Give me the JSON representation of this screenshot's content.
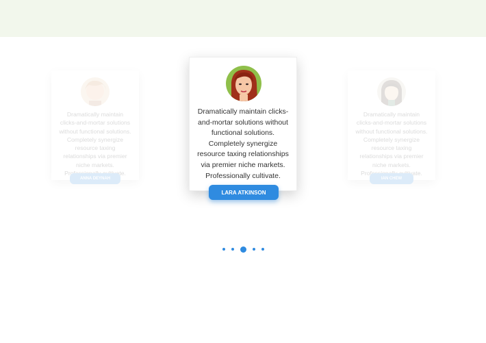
{
  "testimonials": [
    {
      "name": "ANNA DEYNAH",
      "quote": "Dramatically maintain clicks-and-mortar solutions without functional solutions. Completely synergize resource taxing relationships via premier niche markets. Professionally cultivate."
    },
    {
      "name": "LARA ATKINSON",
      "quote": "Dramatically maintain clicks-and-mortar solutions without functional solutions. Completely synergize resource taxing relationships via premier niche markets. Professionally cultivate."
    },
    {
      "name": "IAN CHEW",
      "quote": "Dramatically maintain clicks-and-mortar solutions without functional solutions. Completely synergize resource taxing relationships via premier niche markets. Professionally cultivate."
    }
  ],
  "carousel": {
    "total_slides": 5,
    "active_slide": 3
  },
  "colors": {
    "accent": "#2f8be0",
    "top_band": "#f2f7ec",
    "text": "#333333"
  }
}
